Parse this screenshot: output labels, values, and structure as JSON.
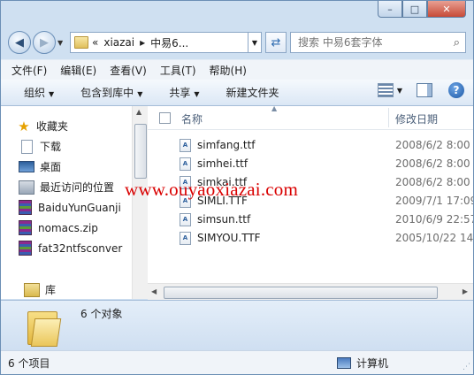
{
  "titlebar": {
    "min": "–",
    "max": "□",
    "close": "✕"
  },
  "address": {
    "prefix": "«",
    "crumbs": [
      "xiazai",
      "中易6..."
    ],
    "separator": "▸"
  },
  "search": {
    "placeholder": "搜索 中易6套字体"
  },
  "menu": [
    "文件(F)",
    "编辑(E)",
    "查看(V)",
    "工具(T)",
    "帮助(H)"
  ],
  "commands": [
    {
      "label": "组织",
      "dropdown": true
    },
    {
      "label": "包含到库中",
      "dropdown": true
    },
    {
      "label": "共享",
      "dropdown": true
    },
    {
      "label": "新建文件夹",
      "dropdown": false
    }
  ],
  "help_label": "?",
  "nav": {
    "items": [
      {
        "label": "收藏夹",
        "icon": "star-icon"
      },
      {
        "label": "下载",
        "icon": "document-icon"
      },
      {
        "label": "桌面",
        "icon": "desktop-icon"
      },
      {
        "label": "最近访问的位置",
        "icon": "recent-places-icon"
      },
      {
        "label": "BaiduYunGuanji",
        "icon": "rar-icon"
      },
      {
        "label": "nomacs.zip",
        "icon": "rar-icon"
      },
      {
        "label": "fat32ntfsconver",
        "icon": "rar-icon"
      },
      {
        "label": "库",
        "icon": "library-icon"
      }
    ]
  },
  "columns": {
    "name": "名称",
    "date": "修改日期"
  },
  "files": [
    {
      "name": "simfang.ttf",
      "date": "2008/6/2 8:00"
    },
    {
      "name": "simhei.ttf",
      "date": "2008/6/2 8:00"
    },
    {
      "name": "simkai.ttf",
      "date": "2008/6/2 8:00"
    },
    {
      "name": "SIMLI.TTF",
      "date": "2009/7/1 17:09"
    },
    {
      "name": "simsun.ttf",
      "date": "2010/6/9 22:57"
    },
    {
      "name": "SIMYOU.TTF",
      "date": "2005/10/22 14:"
    }
  ],
  "file_icon_glyph": "A",
  "details": {
    "count_text": "6 个对象"
  },
  "status": {
    "left": "6 个项目",
    "right": "计算机"
  },
  "watermark": "www.ouyaoxiazai.com"
}
